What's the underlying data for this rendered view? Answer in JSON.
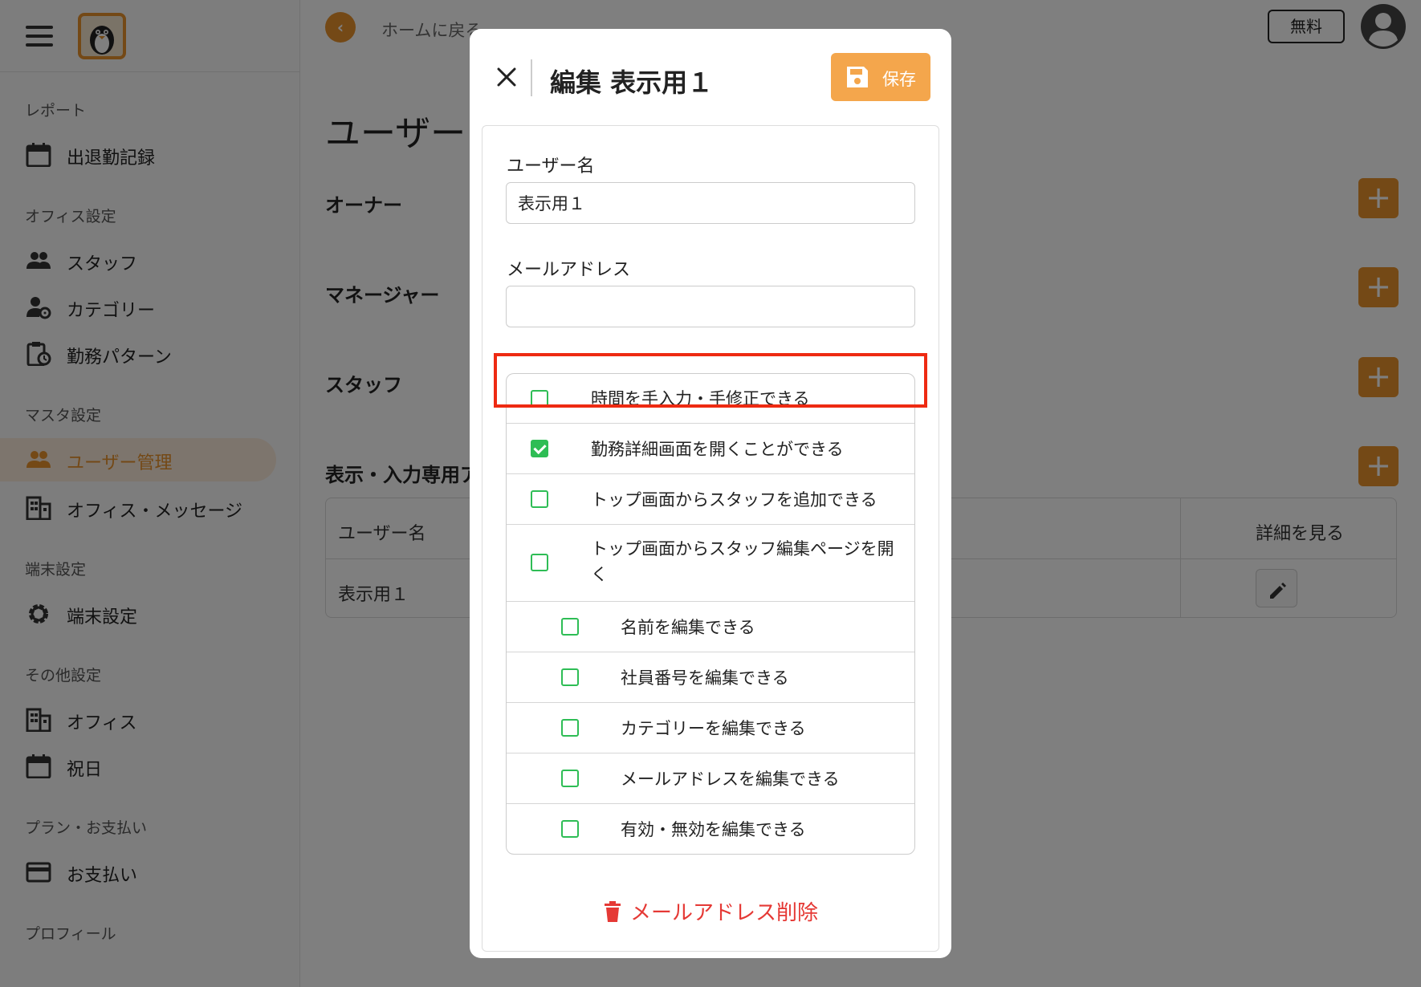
{
  "topbar": {
    "back_text": "ホームに戻る",
    "plan_badge": "無料"
  },
  "sidebar": {
    "sections": [
      {
        "label": "レポート",
        "items": [
          {
            "label": "出退勤記録",
            "icon": "calendar-icon"
          }
        ]
      },
      {
        "label": "オフィス設定",
        "items": [
          {
            "label": "スタッフ",
            "icon": "people-icon"
          },
          {
            "label": "カテゴリー",
            "icon": "person-gear-icon"
          },
          {
            "label": "勤務パターン",
            "icon": "clipboard-clock-icon"
          }
        ]
      },
      {
        "label": "マスタ設定",
        "items": [
          {
            "label": "ユーザー管理",
            "icon": "people-icon",
            "active": true
          },
          {
            "label": "オフィス・メッセージ",
            "icon": "building-icon"
          }
        ]
      },
      {
        "label": "端末設定",
        "items": [
          {
            "label": "端末設定",
            "icon": "gear-icon"
          }
        ]
      },
      {
        "label": "その他設定",
        "items": [
          {
            "label": "オフィス",
            "icon": "building-icon"
          },
          {
            "label": "祝日",
            "icon": "calendar-icon"
          }
        ]
      },
      {
        "label": "プラン・お支払い",
        "items": [
          {
            "label": "お支払い",
            "icon": "credit-card-icon"
          }
        ]
      },
      {
        "label": "プロフィール",
        "items": []
      }
    ]
  },
  "main": {
    "page_title": "ユーザー",
    "groups": [
      "オーナー",
      "マネージャー",
      "スタッフ",
      "表示・入力専用ア"
    ],
    "table": {
      "headers": [
        "ユーザー名",
        "詳細を見る"
      ],
      "rows": [
        [
          "表示用１"
        ]
      ]
    }
  },
  "modal": {
    "title": "編集 表示用１",
    "save_label": "保存",
    "username_label": "ユーザー名",
    "username_value": "表示用１",
    "email_label": "メールアドレス",
    "email_value": "",
    "permissions": [
      {
        "label": "時間を手入力・手修正できる",
        "checked": false,
        "indent": false
      },
      {
        "label": "勤務詳細画面を開くことができる",
        "checked": true,
        "indent": false
      },
      {
        "label": "トップ画面からスタッフを追加できる",
        "checked": false,
        "indent": false
      },
      {
        "label": "トップ画面からスタッフ編集ページを開く",
        "checked": false,
        "indent": false
      },
      {
        "label": "名前を編集できる",
        "checked": false,
        "indent": true
      },
      {
        "label": "社員番号を編集できる",
        "checked": false,
        "indent": true
      },
      {
        "label": "カテゴリーを編集できる",
        "checked": false,
        "indent": true
      },
      {
        "label": "メールアドレスを編集できる",
        "checked": false,
        "indent": true
      },
      {
        "label": "有効・無効を編集できる",
        "checked": false,
        "indent": true
      }
    ],
    "delete_label": "メールアドレス削除"
  },
  "colors": {
    "accent": "#e8922c",
    "save_button": "#f4a64c",
    "checkbox": "#2ebd55",
    "danger": "#e53935",
    "highlight": "#ee2a12"
  }
}
